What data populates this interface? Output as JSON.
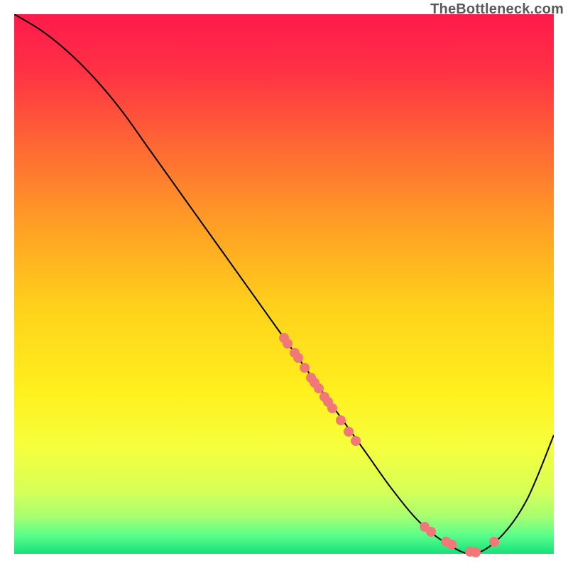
{
  "attribution": "TheBottleneck.com",
  "chart_data": {
    "type": "line",
    "title": "",
    "xlabel": "",
    "ylabel": "",
    "xlim": [
      0,
      100
    ],
    "ylim": [
      0,
      100
    ],
    "grid": false,
    "legend": false,
    "series": [
      {
        "name": "curve",
        "x": [
          0,
          5,
          10,
          15,
          20,
          25,
          30,
          35,
          40,
          45,
          50,
          55,
          60,
          65,
          70,
          75,
          80,
          85,
          90,
          95,
          100
        ],
        "y": [
          100,
          97,
          93,
          88,
          82,
          75,
          68,
          61,
          54,
          47,
          40,
          33,
          26,
          19,
          12,
          6,
          2,
          0,
          3,
          10,
          22
        ],
        "stroke": "#000000",
        "stroke_width": 2
      }
    ],
    "scatter_points": {
      "name": "dots",
      "points": [
        {
          "x": 50.0,
          "y": 40.0
        },
        {
          "x": 50.7,
          "y": 39.0
        },
        {
          "x": 52.0,
          "y": 37.2
        },
        {
          "x": 52.6,
          "y": 36.3
        },
        {
          "x": 53.8,
          "y": 34.5
        },
        {
          "x": 55.0,
          "y": 32.7
        },
        {
          "x": 55.7,
          "y": 31.7
        },
        {
          "x": 56.5,
          "y": 30.6
        },
        {
          "x": 57.5,
          "y": 29.1
        },
        {
          "x": 58.2,
          "y": 28.1
        },
        {
          "x": 59.0,
          "y": 27.0
        },
        {
          "x": 60.5,
          "y": 24.8
        },
        {
          "x": 62.0,
          "y": 22.7
        },
        {
          "x": 63.3,
          "y": 20.9
        },
        {
          "x": 76.0,
          "y": 5.0
        },
        {
          "x": 77.2,
          "y": 4.1
        },
        {
          "x": 80.0,
          "y": 2.2
        },
        {
          "x": 81.0,
          "y": 1.7
        },
        {
          "x": 84.5,
          "y": 0.4
        },
        {
          "x": 85.5,
          "y": 0.3
        },
        {
          "x": 89.0,
          "y": 2.3
        }
      ],
      "color": "#f07878",
      "radius": 7
    },
    "background_gradient": {
      "type": "vertical",
      "stops": [
        {
          "pos": 0.0,
          "color": "#ff1a4b"
        },
        {
          "pos": 0.1,
          "color": "#ff2f45"
        },
        {
          "pos": 0.25,
          "color": "#ff6a33"
        },
        {
          "pos": 0.4,
          "color": "#ffa224"
        },
        {
          "pos": 0.55,
          "color": "#ffd31a"
        },
        {
          "pos": 0.7,
          "color": "#fff01e"
        },
        {
          "pos": 0.8,
          "color": "#f6ff3c"
        },
        {
          "pos": 0.88,
          "color": "#d9ff55"
        },
        {
          "pos": 0.93,
          "color": "#a8ff70"
        },
        {
          "pos": 0.965,
          "color": "#5cff8a"
        },
        {
          "pos": 1.0,
          "color": "#16e07a"
        }
      ]
    }
  }
}
